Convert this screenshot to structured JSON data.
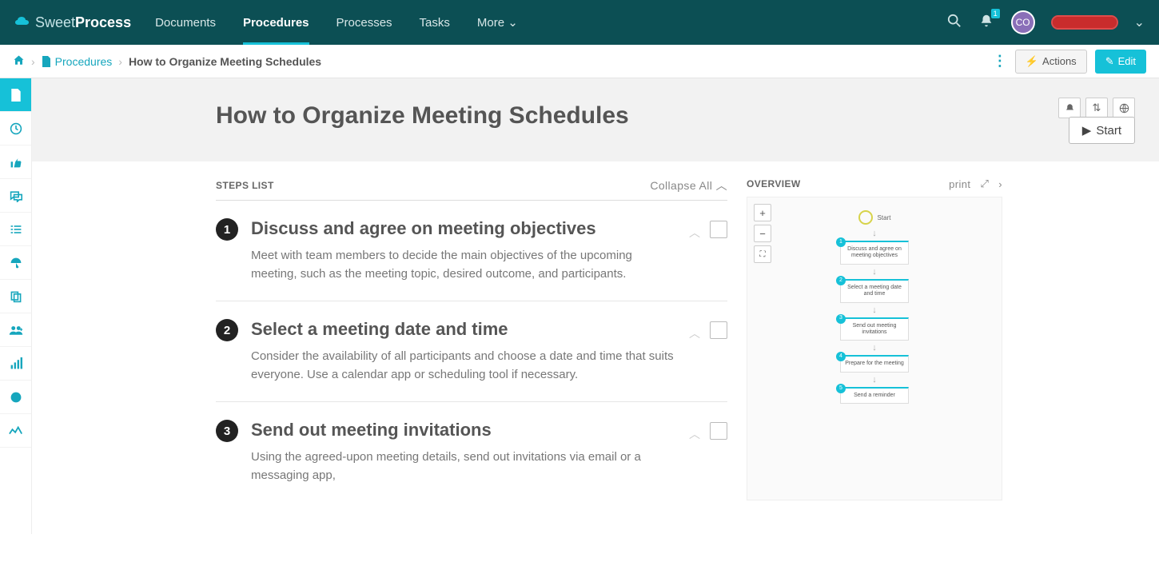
{
  "brand": {
    "light": "Sweet",
    "bold": "Process"
  },
  "nav": {
    "documents": "Documents",
    "procedures": "Procedures",
    "processes": "Processes",
    "tasks": "Tasks",
    "more": "More"
  },
  "notifications": {
    "count": "1"
  },
  "avatar": "CO",
  "crumbs": {
    "procedures": "Procedures",
    "current": "How to Organize Meeting Schedules"
  },
  "buttons": {
    "actions": "Actions",
    "edit": "Edit",
    "start": "Start",
    "collapse": "Collapse All"
  },
  "pageTitle": "How to Organize Meeting Schedules",
  "sections": {
    "steps": "STEPS LIST",
    "overview": "OVERVIEW",
    "print": "print"
  },
  "steps": [
    {
      "n": "1",
      "title": "Discuss and agree on meeting objectives",
      "desc": "Meet with team members to decide the main objectives of the upcoming meeting, such as the meeting topic, desired outcome, and participants."
    },
    {
      "n": "2",
      "title": "Select a meeting date and time",
      "desc": "Consider the availability of all participants and choose a date and time that suits everyone. Use a calendar app or scheduling tool if necessary."
    },
    {
      "n": "3",
      "title": "Send out meeting invitations",
      "desc": "Using the agreed-upon meeting details, send out invitations via email or a messaging app,"
    }
  ],
  "flow": {
    "start": "Start",
    "nodes": [
      {
        "n": "1",
        "t": "Discuss and agree on meeting objectives"
      },
      {
        "n": "2",
        "t": "Select a meeting date and time"
      },
      {
        "n": "3",
        "t": "Send out meeting invitations"
      },
      {
        "n": "4",
        "t": "Prepare for the meeting"
      },
      {
        "n": "5",
        "t": "Send a reminder"
      }
    ]
  }
}
